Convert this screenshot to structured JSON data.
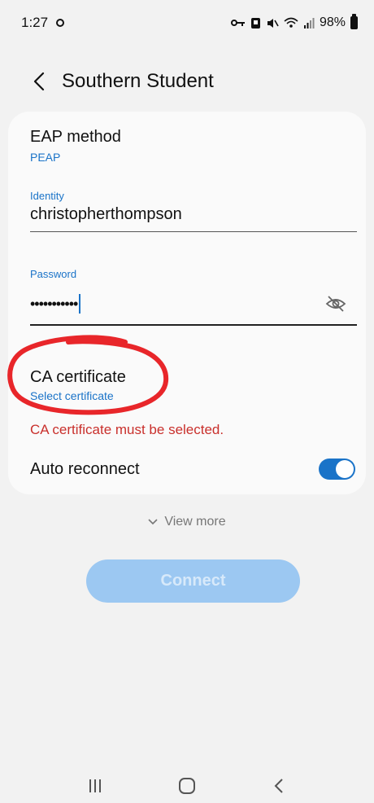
{
  "status_bar": {
    "time": "1:27",
    "battery_percent": "98%",
    "icons": [
      "notification-dot-icon",
      "key-icon",
      "nfc-icon",
      "mute-icon",
      "wifi-icon",
      "signal-icon",
      "battery-icon"
    ]
  },
  "header": {
    "title": "Southern Student",
    "back_icon": "chevron-left-icon"
  },
  "form": {
    "eap_method": {
      "label": "EAP method",
      "value": "PEAP"
    },
    "identity": {
      "label": "Identity",
      "value": "christopherthompson"
    },
    "password": {
      "label": "Password",
      "masked_value": "•••••••••••",
      "visibility_icon": "eye-off-icon"
    },
    "ca_certificate": {
      "label": "CA certificate",
      "value": "Select certificate",
      "error": "CA certificate must be selected."
    },
    "auto_reconnect": {
      "label": "Auto reconnect",
      "enabled": true
    }
  },
  "view_more": {
    "label": "View more"
  },
  "connect_button": {
    "label": "Connect",
    "enabled": false
  },
  "nav_bar": {
    "icons": [
      "recents-icon",
      "home-icon",
      "back-icon"
    ]
  },
  "colors": {
    "accent": "#1a73c8",
    "error": "#c9302c",
    "annotation": "#e8262a",
    "connect_disabled": "#9cc8f2"
  }
}
